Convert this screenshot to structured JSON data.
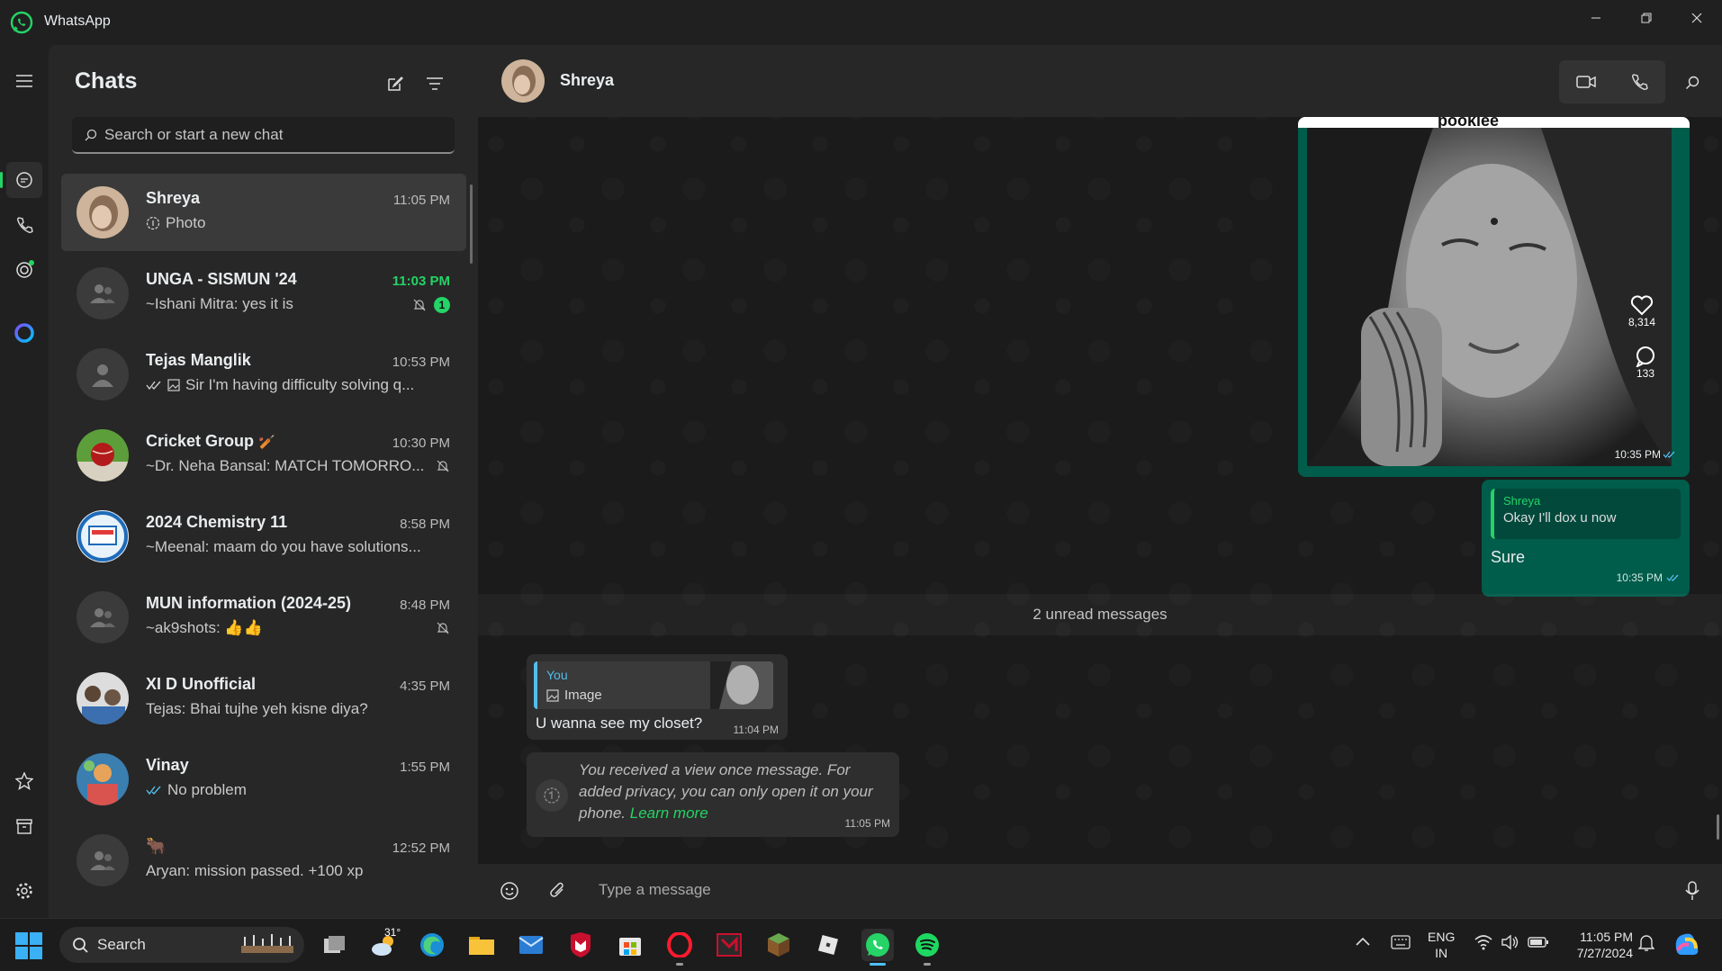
{
  "app": {
    "title": "WhatsApp"
  },
  "sidebar_list": {
    "title": "Chats",
    "search_placeholder": "Search or start a new chat",
    "chats": [
      {
        "name": "Shreya",
        "time": "11:05 PM",
        "preview": "Photo",
        "selected": true
      },
      {
        "name": "UNGA - SISMUN '24",
        "time": "11:03 PM",
        "preview": "~Ishani Mitra: yes it is",
        "unread": "1",
        "muted": true
      },
      {
        "name": "Tejas Manglik",
        "time": "10:53 PM",
        "preview": "Sir I'm having difficulty solving q..."
      },
      {
        "name": "Cricket Group",
        "time": "10:30 PM",
        "preview": "~Dr. Neha Bansal: MATCH TOMORRO...",
        "muted": true
      },
      {
        "name": "2024 Chemistry 11",
        "time": "8:58 PM",
        "preview": "~Meenal: maam do you have solutions..."
      },
      {
        "name": "MUN information (2024-25)",
        "time": "8:48 PM",
        "preview": "~ak9shots: 👍👍",
        "muted": true
      },
      {
        "name": "XI D Unofficial",
        "time": "4:35 PM",
        "preview": "Tejas: Bhai tujhe yeh kisne diya?"
      },
      {
        "name": "Vinay",
        "time": "1:55 PM",
        "preview": "No problem"
      },
      {
        "name": "🐂",
        "time": "12:52 PM",
        "preview": "Aryan: mission passed. +100 xp"
      }
    ]
  },
  "conversation": {
    "contact_name": "Shreya",
    "image_message": {
      "likes": "8,314",
      "comments": "133",
      "time": "10:35 PM",
      "top_text": "pookiee"
    },
    "outgoing_reply": {
      "quoted_name": "Shreya",
      "quoted_text": "Okay I'll dox u now",
      "text": "Sure",
      "time": "10:35 PM"
    },
    "unread_divider": "2 unread messages",
    "incoming_reply": {
      "quoted_name": "You",
      "quoted_text": "Image",
      "text": "U wanna see my closet?",
      "time": "11:04 PM"
    },
    "view_once": {
      "text": "You received a view once message. For added privacy, you can only open it on your phone.",
      "link": "Learn more",
      "time": "11:05 PM"
    },
    "composer_placeholder": "Type a message"
  },
  "taskbar": {
    "search_label": "Search",
    "weather_temp": "31°",
    "language_line1": "ENG",
    "language_line2": "IN",
    "clock_time": "11:05 PM",
    "clock_date": "7/27/2024"
  },
  "colors": {
    "accent": "#25d366",
    "outgoing_bubble": "#005c4b",
    "incoming_bubble": "#2e2e2e"
  }
}
